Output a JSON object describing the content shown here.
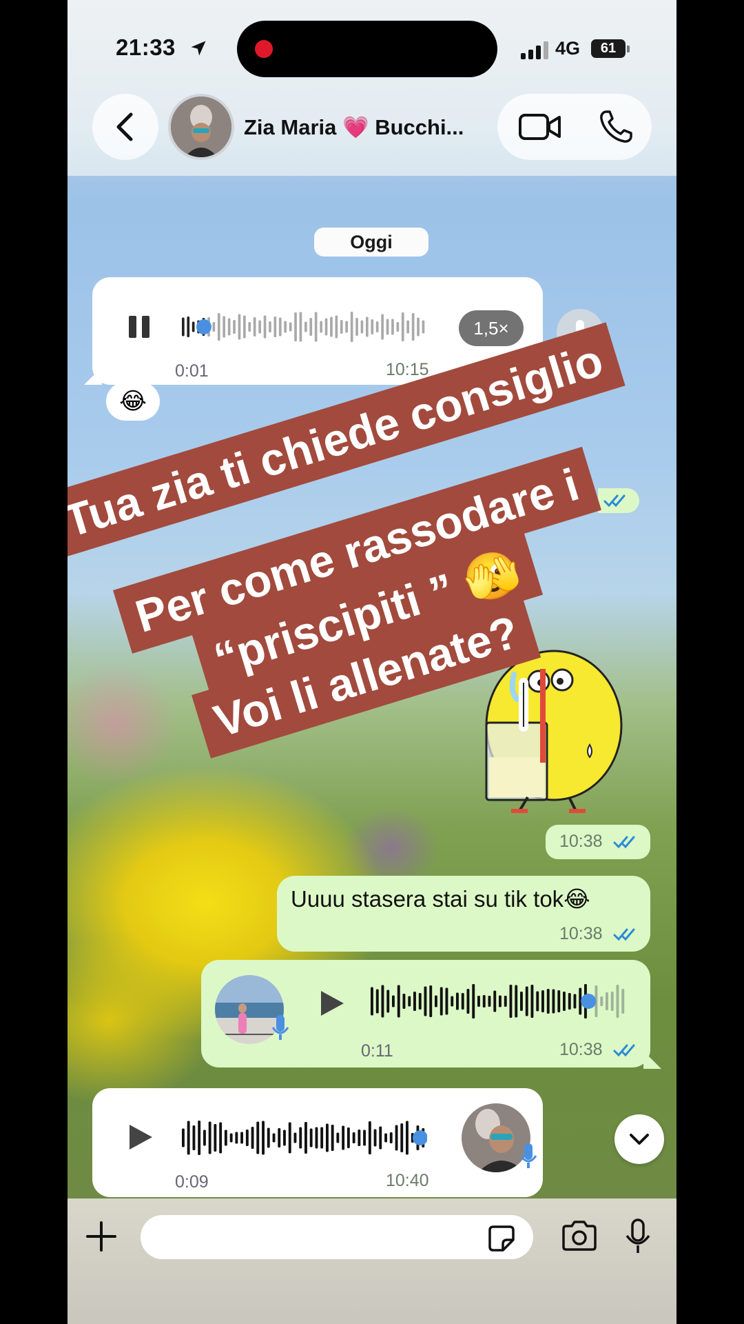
{
  "status_bar": {
    "time": "21:33",
    "network": "4G",
    "battery": "61"
  },
  "header": {
    "contact_name": "Zia Maria 💗 Bucchi..."
  },
  "date_chip": "Oggi",
  "messages": [
    {
      "type": "voice",
      "direction": "incoming",
      "state": "playing",
      "position": "0:01",
      "time": "10:15",
      "speed": "1,5×",
      "progress": 0.09
    },
    {
      "type": "reaction",
      "emoji": "😂"
    },
    {
      "type": "sticker",
      "direction": "outgoing",
      "time": "10:38"
    },
    {
      "type": "text",
      "direction": "outgoing",
      "text": "Uuuu stasera stai su tik tok😂",
      "time": "10:38"
    },
    {
      "type": "voice",
      "direction": "outgoing",
      "duration": "0:11",
      "time": "10:38",
      "progress": 0.85
    },
    {
      "type": "voice",
      "direction": "incoming",
      "duration": "0:09",
      "time": "10:40",
      "progress": 1.0
    }
  ],
  "caption": {
    "lines": [
      "Tua zia ti chiede consiglio",
      "Per come rassodare i",
      "“priscipiti ” 🫣",
      "Voi li allenate?"
    ]
  },
  "input": {
    "placeholder": ""
  },
  "colors": {
    "outgoing_bubble": "#dcf8c6",
    "incoming_bubble": "#ffffff",
    "caption_bg": "#a24a3d",
    "read_ticks": "#2a8bd6",
    "progress_dot": "#4a90e2"
  }
}
